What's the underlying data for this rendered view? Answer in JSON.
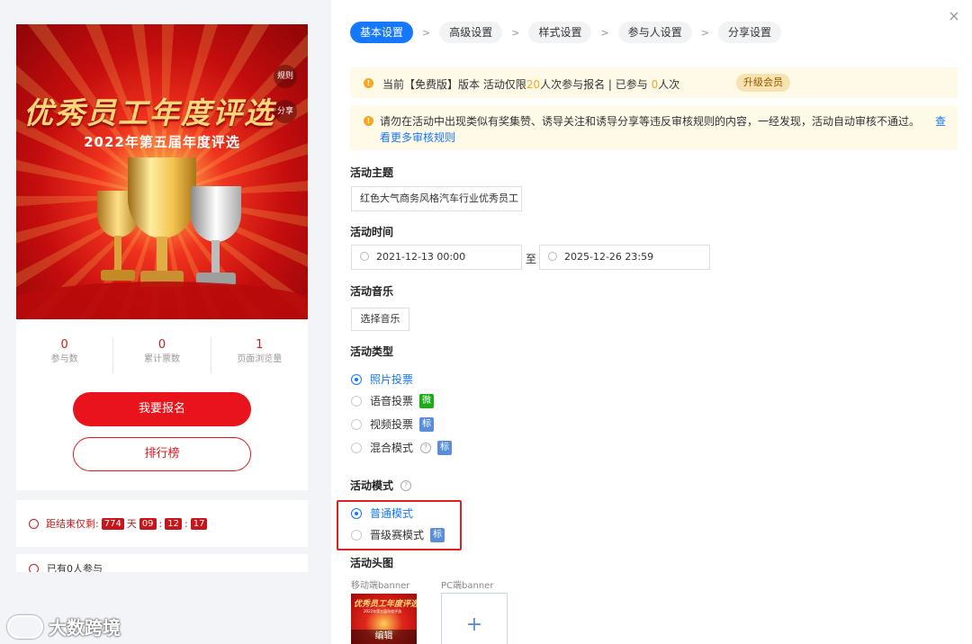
{
  "preview": {
    "rules_tag": "规则",
    "share_tag": "分享",
    "hero_title": "优秀员工年度评选",
    "hero_subtitle": "2022年第五届年度评选",
    "stats": [
      {
        "value": "0",
        "label": "参与数"
      },
      {
        "value": "0",
        "label": "累计票数"
      },
      {
        "value": "1",
        "label": "页面浏览量"
      }
    ],
    "signup_button": "我要报名",
    "ranking_button": "排行榜",
    "countdown": {
      "prefix": "距结束仅剩:",
      "days": "774",
      "days_unit": "天",
      "hours": "09",
      "minutes": "12",
      "seconds": "17",
      "separator": ":"
    },
    "participants_text": "已有0人参与"
  },
  "watermark": "大数跨境",
  "steps": [
    {
      "label": "基本设置",
      "active": true
    },
    {
      "label": "高级设置"
    },
    {
      "label": "样式设置"
    },
    {
      "label": "参与人设置"
    },
    {
      "label": "分享设置"
    }
  ],
  "step_separator": ">",
  "close_glyph": "×",
  "notice1": {
    "part1": "当前【免费版】版本 活动仅限",
    "limit": "20",
    "part2": "人次参与报名 | 已参与 ",
    "joined": "0",
    "part3": "人次",
    "upgrade": "升级会员"
  },
  "notice2": {
    "text": "请勿在活动中出现类似有奖集赞、诱导关注和诱导分享等违反审核规则的内容，一经发现，活动自动审核不通过。",
    "link_head": "查",
    "link_tail": "看更多审核规则"
  },
  "form": {
    "theme_label": "活动主题",
    "theme_value": "红色大气商务风格汽车行业优秀员工",
    "time_label": "活动时间",
    "start_time": "2021-12-13 00:00",
    "to_text": "至",
    "end_time": "2025-12-26 23:59",
    "music_label": "活动音乐",
    "music_button": "选择音乐",
    "type_label": "活动类型",
    "types": [
      {
        "label": "照片投票",
        "selected": true
      },
      {
        "label": "语音投票",
        "badge": "微"
      },
      {
        "label": "视频投票",
        "badge": "标"
      },
      {
        "label": "混合模式",
        "badge": "标"
      }
    ],
    "mode_label": "活动模式",
    "modes": [
      {
        "label": "普通模式",
        "selected": true
      },
      {
        "label": "晋级赛模式",
        "badge": "标"
      }
    ],
    "header_label": "活动头图",
    "mobile_banner_label": "移动端banner",
    "pc_banner_label": "PC端banner",
    "edit_label": "编辑",
    "upload_glyph": "+"
  },
  "colors": {
    "primary": "#1677ff",
    "red": "#e8131b",
    "notice_bg": "#fff9e8",
    "warning": "#f5a623"
  }
}
